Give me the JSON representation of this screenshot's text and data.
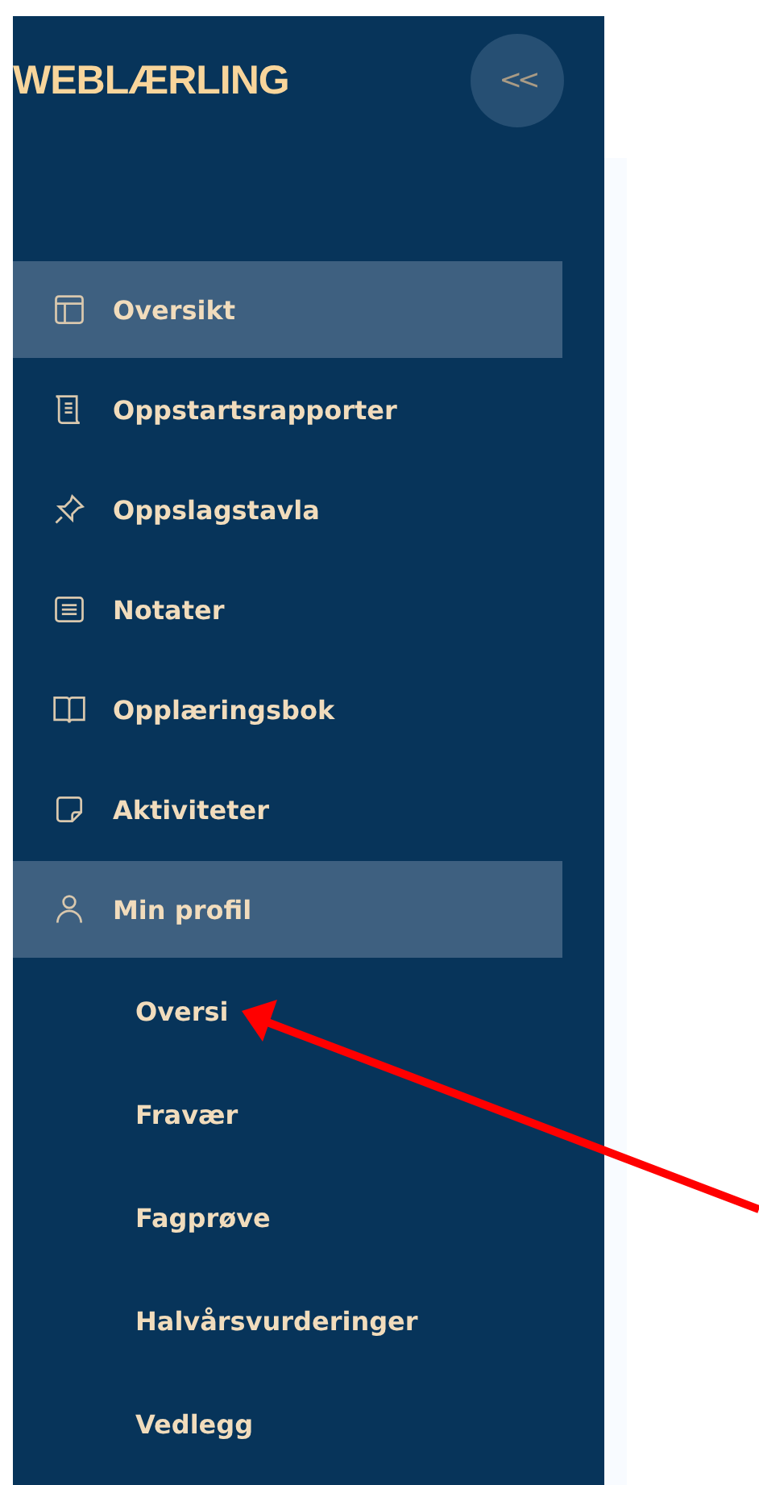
{
  "sidebar": {
    "logo": "WEBLÆRLING",
    "collapse_button": "<<",
    "items": [
      {
        "label": "Oversikt",
        "kind": "layout",
        "selected": true
      },
      {
        "label": "Oppstartsrapporter",
        "kind": "scroll",
        "selected": false
      },
      {
        "label": "Oppslagstavla",
        "kind": "pin",
        "selected": false
      },
      {
        "label": "Notater",
        "kind": "note",
        "selected": false
      },
      {
        "label": "Opplæringsbok",
        "kind": "book",
        "selected": false
      },
      {
        "label": "Aktiviteter",
        "kind": "sticky",
        "selected": false
      },
      {
        "label": "Min profil",
        "kind": "person",
        "selected": true,
        "children": [
          {
            "label": "Oversi"
          },
          {
            "label": "Fravær"
          },
          {
            "label": "Fagprøve"
          },
          {
            "label": "Halvårsvurderinger"
          },
          {
            "label": "Vedlegg"
          }
        ]
      }
    ]
  }
}
